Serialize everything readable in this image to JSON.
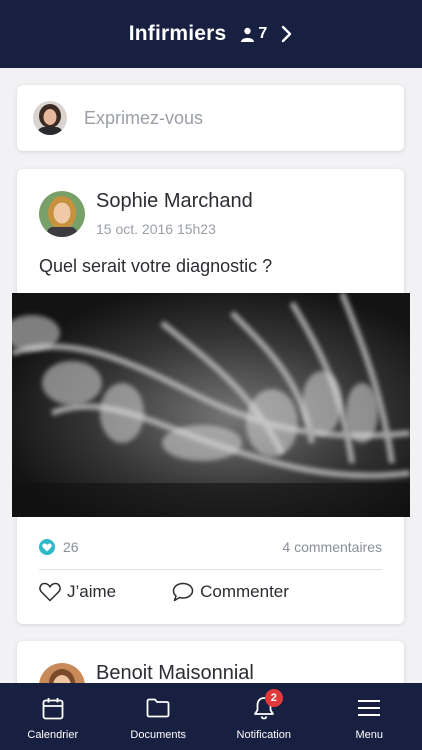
{
  "header": {
    "title": "Infirmiers",
    "member_count": "7"
  },
  "composer": {
    "placeholder": "Exprimez-vous"
  },
  "posts": [
    {
      "author": "Sophie Marchand",
      "timestamp": "15 oct. 2016 15h23",
      "text": "Quel serait votre diagnostic ?",
      "image_icon": "xray-image",
      "likes": "26",
      "comments": "4 commentaires",
      "like_label": "J’aime",
      "comment_label": "Commenter"
    },
    {
      "author": "Benoit Maisonnial"
    }
  ],
  "tabbar": {
    "items": [
      {
        "label": "Calendrier",
        "icon": "calendar-icon"
      },
      {
        "label": "Documents",
        "icon": "folder-icon"
      },
      {
        "label": "Notification",
        "icon": "bell-icon",
        "badge": "2"
      },
      {
        "label": "Menu",
        "icon": "hamburger-icon"
      }
    ]
  },
  "colors": {
    "navy": "#172040",
    "accent": "#2fb8c8",
    "badge": "#e23a3a"
  }
}
